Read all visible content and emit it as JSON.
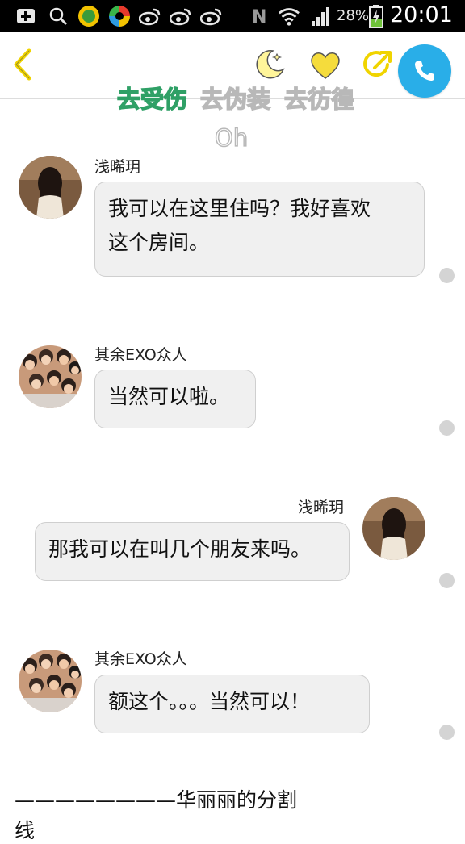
{
  "status_bar": {
    "battery_percent": "28%",
    "time": "20:01",
    "icons": [
      "add-notification-icon",
      "search-icon",
      "app-badge-icon",
      "app-color-icon",
      "weibo-icon",
      "weibo-icon",
      "weibo-icon",
      "nfc-icon",
      "wifi-icon",
      "signal-icon",
      "battery-charging-icon"
    ]
  },
  "top_bar": {
    "icons": [
      "back-chevron-icon",
      "moon-icon",
      "heart-icon",
      "share-icon",
      "phone-icon"
    ],
    "accent_color": "#f0d400",
    "call_color": "#29aee8"
  },
  "lyrics": {
    "segments": [
      "去受伤",
      "去伪装",
      "去彷徨"
    ],
    "active_index": 0,
    "next_line": "Oh",
    "active_color": "#3fce86"
  },
  "messages": [
    {
      "side": "left",
      "sender": "浅晞玥",
      "text_lines": [
        "我可以在这里住吗？我好喜欢",
        "这个房间。"
      ],
      "avatar": "girl-avatar"
    },
    {
      "side": "left",
      "sender": "其余EXO众人",
      "text_lines": [
        "当然可以啦。"
      ],
      "avatar": "group-avatar"
    },
    {
      "side": "right",
      "sender": "浅晞玥",
      "text_lines": [
        "那我可以在叫几个朋友来吗。"
      ],
      "avatar": "girl-avatar"
    },
    {
      "side": "left",
      "sender": "其余EXO众人",
      "text_lines": [
        "额这个。。。当然可以！"
      ],
      "avatar": "group-avatar"
    }
  ],
  "footer": {
    "line1": "————————华丽丽的分割",
    "line2": "线"
  }
}
